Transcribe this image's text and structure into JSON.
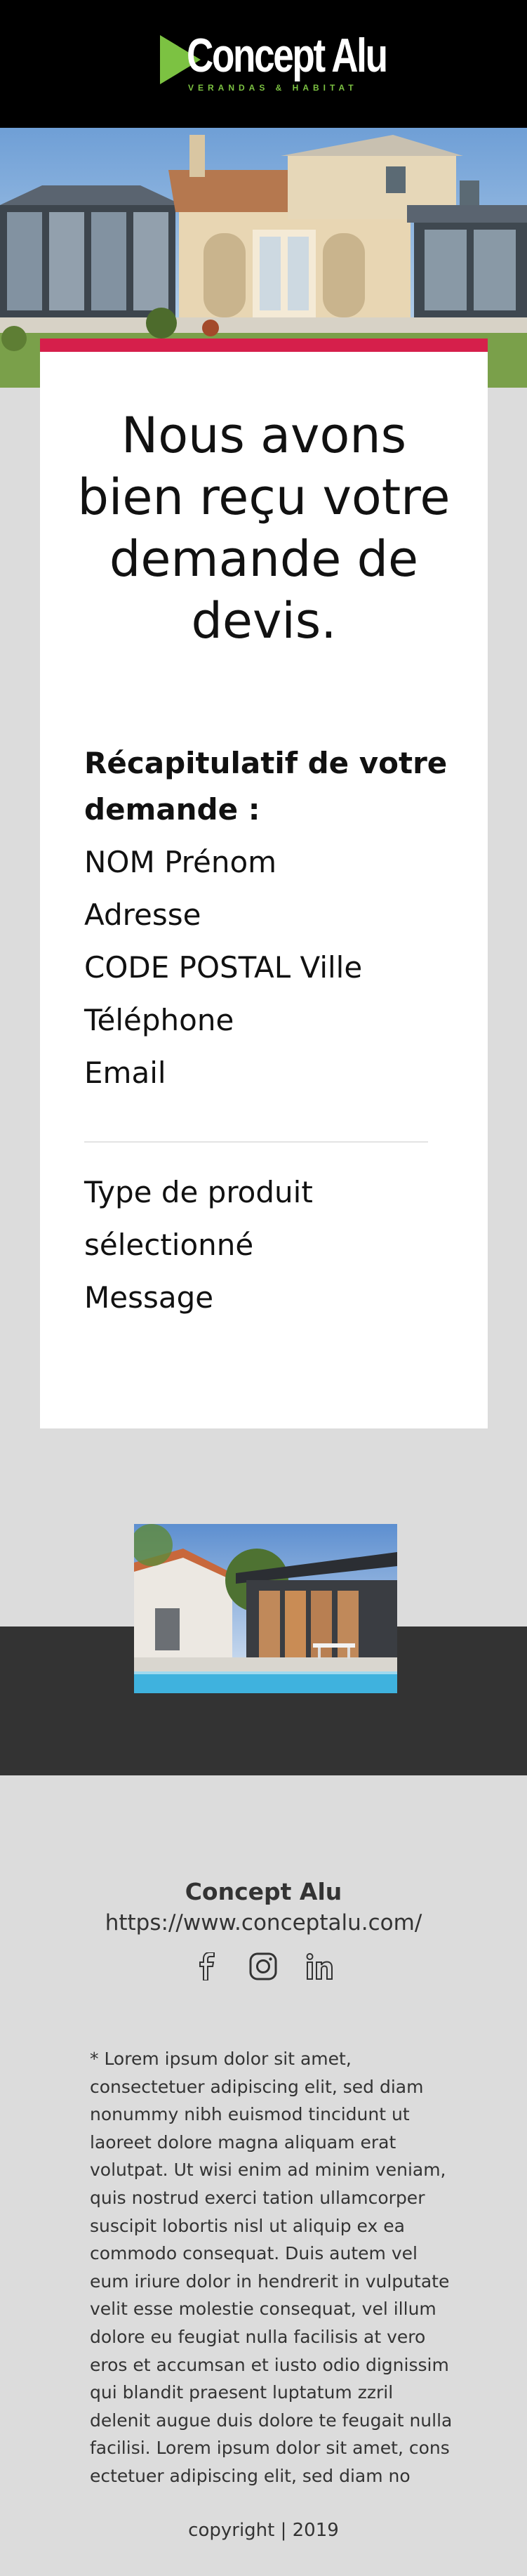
{
  "header": {
    "logo_name": "Concept Alu",
    "logo_tagline": "VERANDAS & HABITAT"
  },
  "confirmation": {
    "title": "Nous avons bien reçu votre demande de devis."
  },
  "recap": {
    "title": "Récapitulatif de votre demande :",
    "name": "NOM Prénom",
    "address": "Adresse",
    "postal_city": "CODE POSTAL Ville",
    "phone": "Téléphone",
    "email": "Email",
    "product_line1": "Type de produit",
    "product_line2": "sélectionné",
    "message": "Message"
  },
  "footer": {
    "company": "Concept Alu",
    "website": "https://www.conceptalu.com/",
    "socials": [
      "facebook-icon",
      "instagram-icon",
      "linkedin-icon"
    ],
    "disclaimer": "* Lorem ipsum dolor sit amet, consectetuer adipiscing elit, sed diam nonummy nibh euismod tincidunt ut laoreet dolore magna aliquam erat volutpat. Ut wisi enim ad minim veniam, quis nostrud exerci tation ullamcorper suscipit lobortis nisl ut aliquip ex ea commodo consequat. Duis autem vel eum iriure dolor in hendrerit in vulputate velit esse molestie consequat, vel illum dolore eu feugiat nulla facilisis at vero eros et accumsan et iusto odio dignissim qui blandit praesent luptatum zzril delenit augue duis dolore te feugait nulla facilisi. Lorem ipsum dolor sit amet, cons ectetuer adipiscing elit, sed diam no",
    "copyright": "copyright | 2019"
  },
  "colors": {
    "accent": "#d61f4b",
    "brand_green": "#7cc242",
    "header_bg": "#000000",
    "page_bg": "#dcdcdc",
    "dark_band": "#333333"
  }
}
